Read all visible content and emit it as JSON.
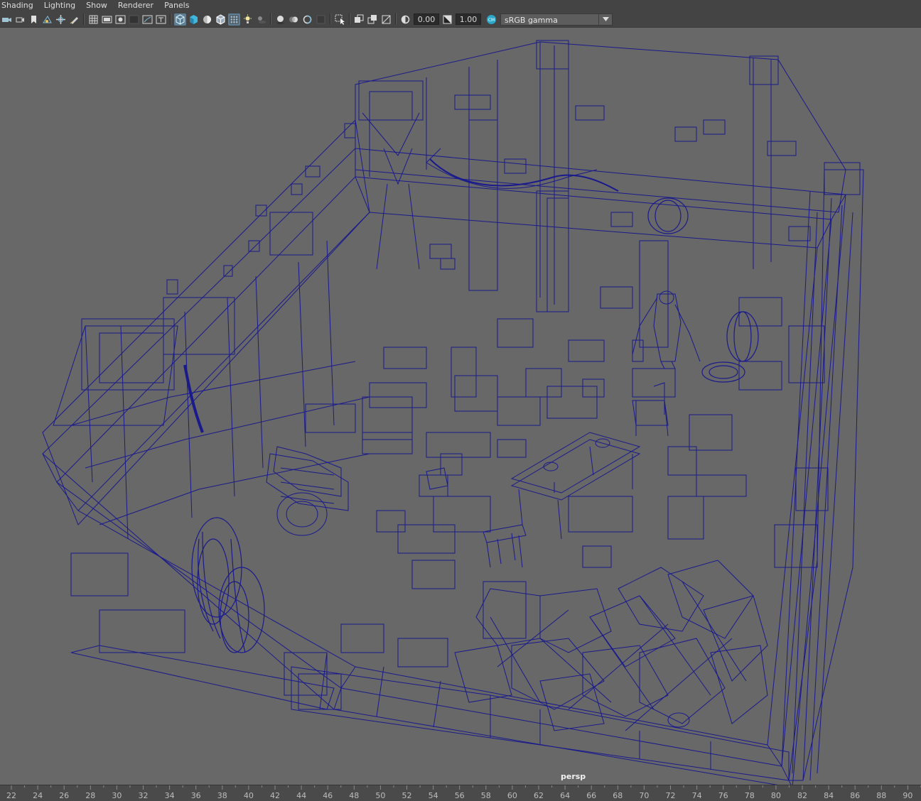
{
  "menu": {
    "items": [
      "Shading",
      "Lighting",
      "Show",
      "Renderer",
      "Panels"
    ]
  },
  "toolbar": {
    "exposure_value": "0.00",
    "gamma_value": "1.00",
    "color_space": "sRGB gamma",
    "accent_color": "#5d7f95",
    "icons": [
      "select-camera-icon",
      "camera-attributes-icon",
      "bookmark-icon",
      "image-plane-icon",
      "2d-pan-zoom-icon",
      "grease-pencil-icon",
      "grid-icon",
      "film-gate-icon",
      "resolution-gate-icon",
      "gate-mask-icon",
      "field-chart-icon",
      "safe-action-icon",
      "wireframe-icon",
      "smooth-shade-icon",
      "use-default-material-icon",
      "wireframe-on-shaded-icon",
      "xray-icon",
      "use-all-lights-icon",
      "shadows-icon",
      "screen-space-ao-icon",
      "motion-blur-icon",
      "multisample-aa-icon",
      "depth-of-field-icon",
      "isolate-select-icon",
      "xray-active-components-icon",
      "xray-joints-icon",
      "backface-culling-icon",
      "exposure-icon",
      "gamma-icon",
      "color-management-icon"
    ]
  },
  "viewport": {
    "camera_label": "persp",
    "wire_color": "#1a1a8c",
    "background_color": "#686868"
  },
  "timeline": {
    "frames": [
      "22",
      "24",
      "26",
      "28",
      "30",
      "32",
      "34",
      "36",
      "38",
      "40",
      "42",
      "44",
      "46",
      "48",
      "50",
      "52",
      "54",
      "56",
      "58",
      "60",
      "62",
      "64",
      "66",
      "68",
      "70",
      "72",
      "74",
      "76",
      "78",
      "80",
      "82",
      "84",
      "86",
      "88",
      "90"
    ]
  }
}
